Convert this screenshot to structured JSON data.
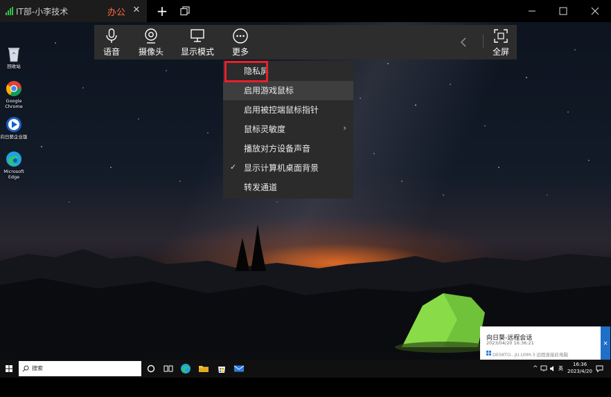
{
  "tab": {
    "title": "IT部-小李技术",
    "status": "办公"
  },
  "toolbar": {
    "voice_label": "语音",
    "camera_label": "摄像头",
    "display_mode_label": "显示模式",
    "more_label": "更多",
    "fullscreen_label": "全屏"
  },
  "menu": {
    "items": [
      {
        "label": "隐私屏",
        "checked": false,
        "submenu": false
      },
      {
        "label": "启用游戏鼠标",
        "checked": false,
        "submenu": false
      },
      {
        "label": "启用被控端鼠标指针",
        "checked": false,
        "submenu": false
      },
      {
        "label": "鼠标灵敏度",
        "checked": false,
        "submenu": true
      },
      {
        "label": "播放对方设备声音",
        "checked": false,
        "submenu": false
      },
      {
        "label": "显示计算机桌面背景",
        "checked": true,
        "submenu": false
      },
      {
        "label": "转发通道",
        "checked": false,
        "submenu": false
      }
    ]
  },
  "desktop_icons": [
    {
      "label": "回收站",
      "icon": "recycle-bin-icon"
    },
    {
      "label": "Google Chrome",
      "icon": "chrome-icon"
    },
    {
      "label": "向日葵企业版",
      "icon": "sunlogin-icon"
    },
    {
      "label": "Microsoft Edge",
      "icon": "edge-icon"
    }
  ],
  "notification": {
    "title": "向日葵-远程会话",
    "time": "2023/04/20 16:36:21",
    "body": "DESKTO...JU.U0M.3 远程连接此电脑",
    "close": "×"
  },
  "taskbar": {
    "search_placeholder": "搜索",
    "time": "16:36",
    "date": "2023/4/20",
    "ime": "英"
  },
  "colors": {
    "status_accent": "#ff6a3d",
    "highlight_border": "#e8202a",
    "signal": "#35c24a"
  }
}
